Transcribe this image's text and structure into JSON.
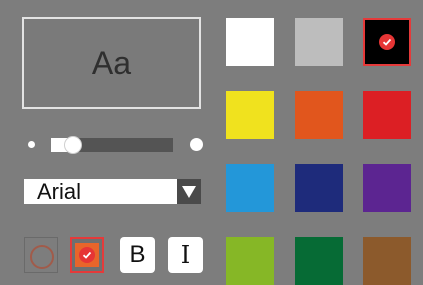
{
  "preview": {
    "text": "Aa"
  },
  "size_slider": {
    "value": 0.17
  },
  "font_select": {
    "value": "Arial"
  },
  "style_tools": {
    "bold_label": "B",
    "italic_label": "I"
  },
  "colors": {
    "accent": "#e53a3a",
    "swatches": [
      "#ffffff",
      "#bdbdbd",
      "#000000",
      "#f0e21e",
      "#e1561d",
      "#dc1f24",
      "#2397d9",
      "#1e2b7b",
      "#5c2591",
      "#86b726",
      "#066b35",
      "#8c5a2c"
    ],
    "selected_index": 2
  }
}
